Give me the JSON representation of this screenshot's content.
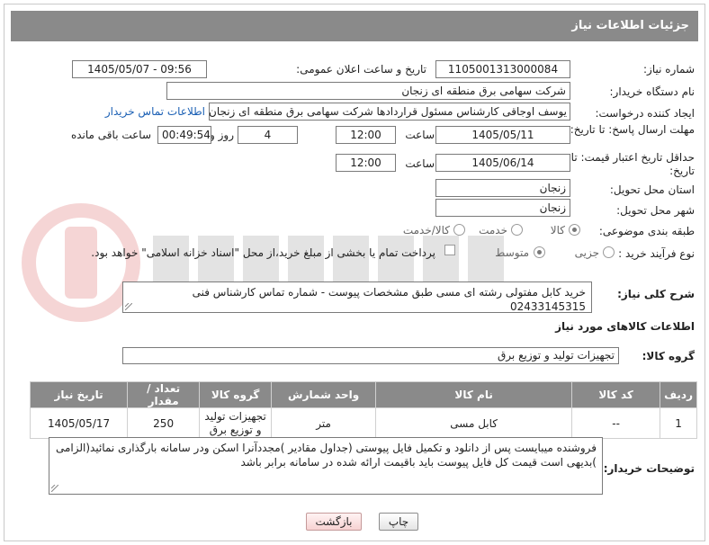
{
  "header": {
    "title": "جزئیات اطلاعات نیاز"
  },
  "fields": {
    "need_number_label": "شماره نیاز:",
    "need_number": "1105001313000084",
    "announce_label": "تاریخ و ساعت اعلان عمومی:",
    "announce_value": "1405/05/07 - 09:56",
    "buyer_org_label": "نام دستگاه خریدار:",
    "buyer_org": "شرکت سهامی برق منطقه ای زنجان",
    "creator_label": "ایجاد کننده درخواست:",
    "creator": "یوسف اوجاقی کارشناس مسئول قراردادها شرکت سهامی برق منطقه ای زنجان",
    "contact_link": "اطلاعات تماس خریدار",
    "reply_deadline_label": "مهلت ارسال پاسخ: تا تاریخ:",
    "reply_date": "1405/05/11",
    "time_label": "ساعت",
    "reply_time": "12:00",
    "days_value": "4",
    "days_label": "روز و",
    "remaining_value": "00:49:54",
    "remaining_label": "ساعت باقی مانده",
    "price_deadline_label": "حداقل تاریخ اعتبار قیمت: تا تاریخ:",
    "price_date": "1405/06/14",
    "price_time": "12:00",
    "province_label": "استان محل تحویل:",
    "province": "زنجان",
    "city_label": "شهر محل تحویل:",
    "city": "زنجان",
    "category_label": "طبقه بندی موضوعی:",
    "category_options": [
      "کالا",
      "خدمت",
      "کالا/خدمت"
    ],
    "process_label": "نوع فرآیند خرید :",
    "process_options": [
      "جزیی",
      "متوسط"
    ],
    "payment_note": "پرداخت تمام یا بخشی از مبلغ خرید،از محل \"اسناد خزانه اسلامی\" خواهد بود."
  },
  "description": {
    "label": "شرح کلی نیاز:",
    "text": "خرید کابل مفتولی رشته ای مسی طبق مشخصات پیوست - شماره تماس کارشناس فنی 02433145315"
  },
  "goods": {
    "section_title": "اطلاعات کالاهای مورد نیاز",
    "group_label": "گروه کالا:",
    "group_value": "تجهیزات تولید و توزیع برق"
  },
  "table": {
    "headers": [
      "ردیف",
      "کد کالا",
      "نام کالا",
      "واحد شمارش",
      "گروه کالا",
      "تعداد / مقدار",
      "تاریخ نیاز"
    ],
    "rows": [
      {
        "row": "1",
        "code": "--",
        "name": "کابل مسی",
        "unit": "متر",
        "group": "تجهیزات تولید و توزیع برق",
        "qty": "250",
        "date": "1405/05/17"
      }
    ]
  },
  "buyer_notes": {
    "label": "توضیحات خریدار:",
    "text": "فروشنده میبایست پس از دانلود و تکمیل فایل پیوستی (جداول مقادیر )مجددآنرا اسکن ودر سامانه بارگذاری نمائید(الزامی )بدیهی است قیمت کل فایل پیوست باید باقیمت ارائه شده در سامانه برابر باشد"
  },
  "buttons": {
    "print": "چاپ",
    "back": "بازگشت"
  },
  "colors": {
    "header_bg": "#8a8a8a",
    "link": "#1a5fb4"
  }
}
